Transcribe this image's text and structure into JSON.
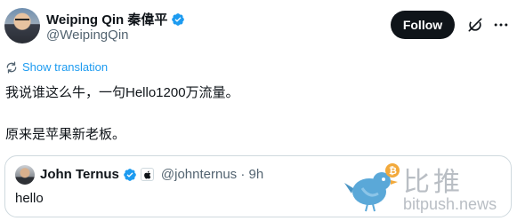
{
  "author": {
    "display_name": "Weiping Qin 秦偉平",
    "handle": "@WeipingQin"
  },
  "actions": {
    "follow_label": "Follow"
  },
  "translation": {
    "label": "Show translation"
  },
  "tweet": {
    "line1": "我说谁这么牛，一句Hello1200万流量。",
    "line2": "原来是苹果新老板。"
  },
  "quoted": {
    "display_name": "John Ternus",
    "handle_time": "@johnternus · 9h",
    "text": "hello"
  },
  "watermark": {
    "cn": "比推",
    "en": "bitpush.news"
  },
  "colors": {
    "accent": "#1d9bf0",
    "text": "#0f1419",
    "muted": "#536471"
  }
}
